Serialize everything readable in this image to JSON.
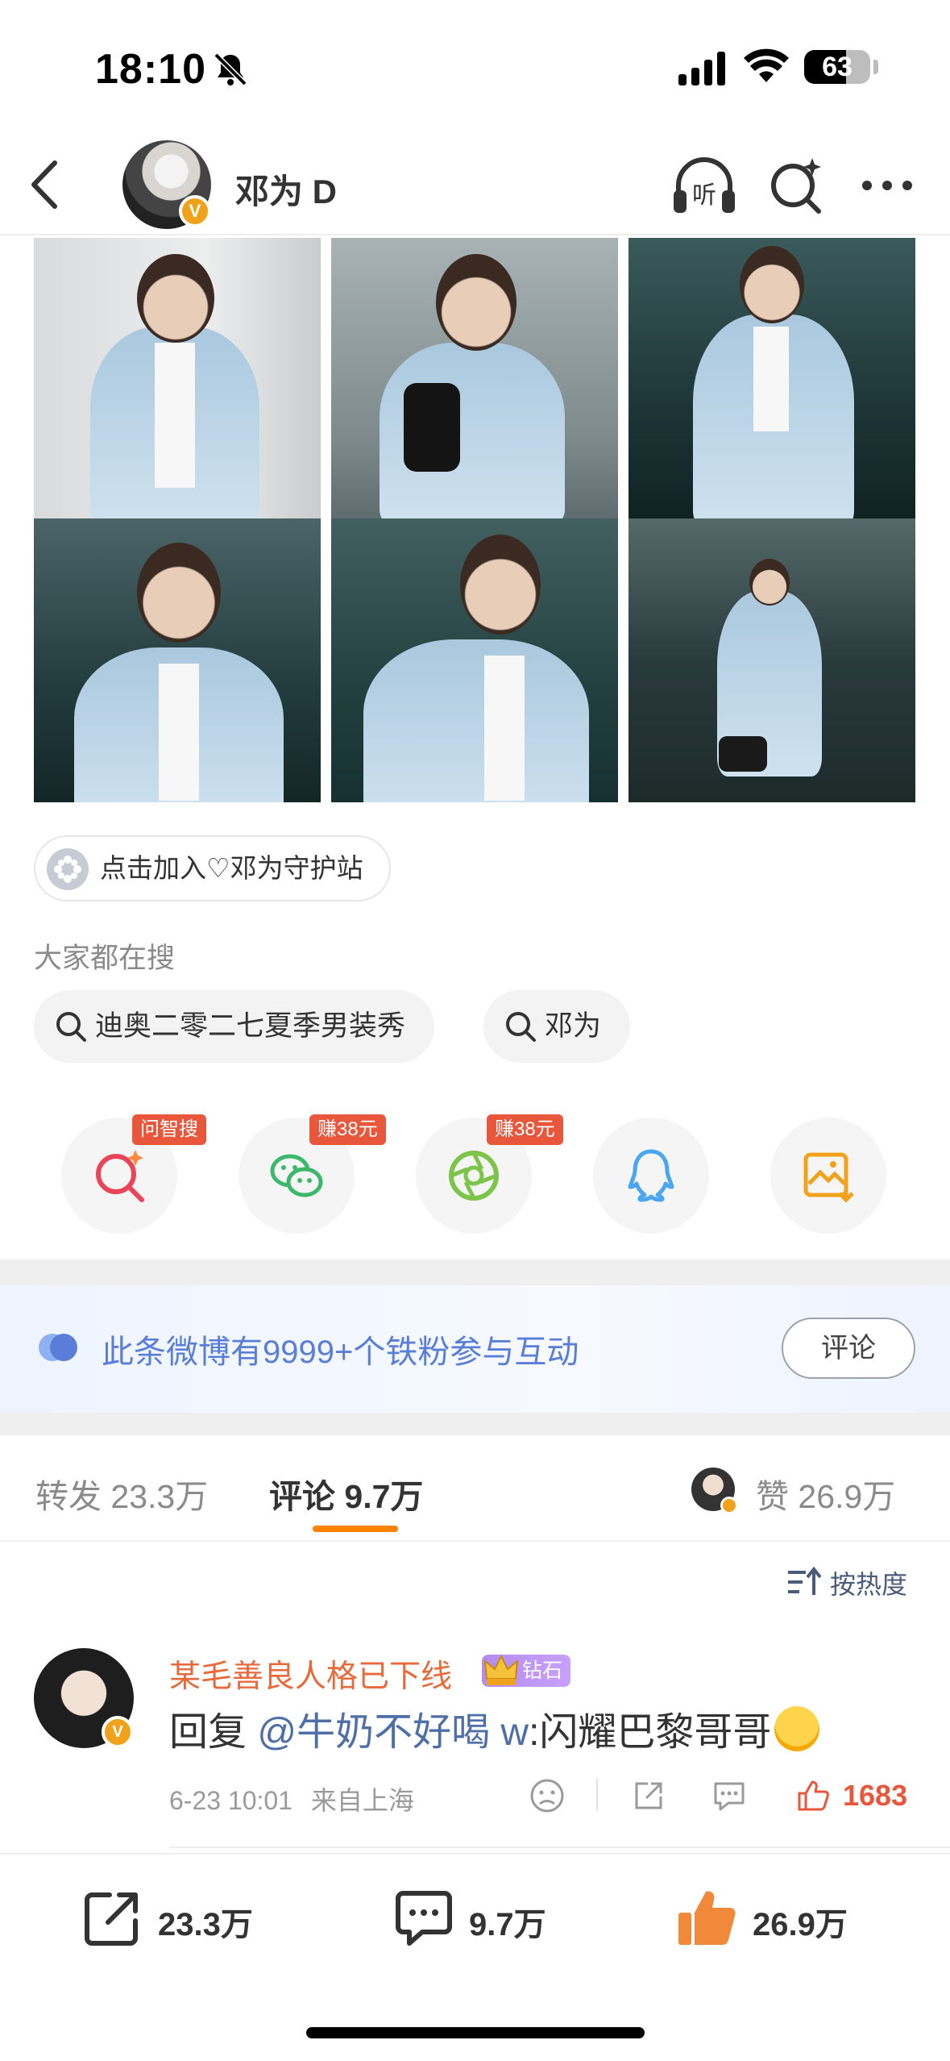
{
  "status_bar": {
    "time": "18:10",
    "battery": "63",
    "battery_level": 0.63
  },
  "header": {
    "title": "邓为 D",
    "verified": "V"
  },
  "supertopic_chip": {
    "label": "点击加入♡邓为守护站"
  },
  "trending": {
    "label": "大家都在搜",
    "chips": [
      "迪奥二零二七夏季男装秀",
      "邓为"
    ]
  },
  "share_row": {
    "badges": [
      "问智搜",
      "赚38元",
      "赚38元"
    ],
    "icons": [
      "ai-search-icon",
      "wechat-icon",
      "moments-icon",
      "qq-icon",
      "save-image-icon"
    ]
  },
  "fans_banner": {
    "text": "此条微博有9999+个铁粉参与互动",
    "button": "评论"
  },
  "tabs": {
    "repost": "转发 23.3万",
    "comment": "评论 9.7万",
    "like": "赞 26.9万"
  },
  "sort": {
    "label": "按热度"
  },
  "comment": {
    "username": "某毛善良人格已下线",
    "badge": "钻石",
    "text_prefix": "回复",
    "mention": "@牛奶不好喝 w",
    "text_suffix": ":闪耀巴黎哥哥",
    "time": "6-23 10:01",
    "location": "来自上海",
    "likes": "1683",
    "verified": "V"
  },
  "bottom_bar": {
    "repost": "23.3万",
    "comment": "9.7万",
    "like": "26.9万"
  },
  "colors": {
    "accent": "#ff8200",
    "like_red": "#e8563b",
    "link_blue": "#4e6ea8",
    "fans_blue": "#5a7ed8"
  }
}
